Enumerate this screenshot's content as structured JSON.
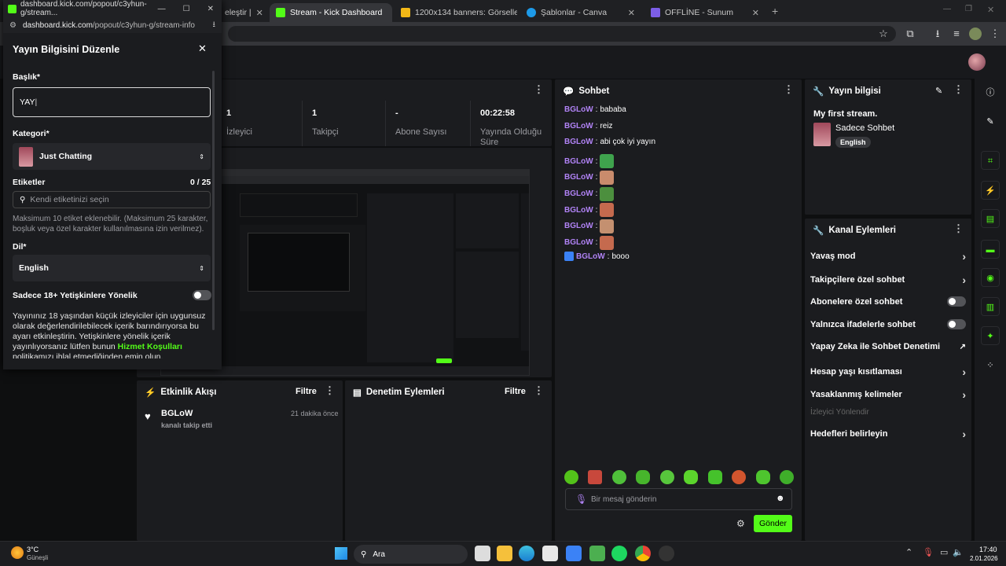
{
  "browser_tabs": [
    {
      "label": "eleştir | ",
      "icon": "gen-icon"
    },
    {
      "label": "Stream - Kick Dashboard",
      "icon": "kick-icon",
      "active": true
    },
    {
      "label": "1200x134 banners: Görselleri g",
      "icon": "banner-icon"
    },
    {
      "label": "Şablonlar - Canva",
      "icon": "canva-icon"
    },
    {
      "label": "OFFLİNE - Sunum",
      "icon": "slides-icon"
    }
  ],
  "popup": {
    "window_title": "dashboard.kick.com/popout/c3yhun-g/stream...",
    "url_host": "dashboard.kick.com",
    "url_path": "/popout/c3yhun-g/stream-info",
    "heading": "Yayın Bilgisini Düzenle",
    "title_label": "Başlık*",
    "title_value": "YAY",
    "category_label": "Kategori*",
    "category_value": "Just Chatting",
    "tags_label": "Etiketler",
    "tags_count": "0 / 25",
    "tags_placeholder": "Kendi etiketinizi seçin",
    "tags_help": "Maksimum 10 etiket eklenebilir. (Maksimum 25 karakter, boşluk veya özel karakter kullanılmasına izin verilmez).",
    "lang_label": "Dil*",
    "lang_value": "English",
    "adult_label": "Sadece 18+ Yetişkinlere Yönelik",
    "adult_help_1": "Yayınınız 18 yaşından küçük izleyiciler için uygunsuz olarak değerlendirilebilecek içerik barındırıyorsa bu ayarı etkinleştirin. Yetişkinlere yönelik içerik yayınlıyorsanız lütfen bunun ",
    "adult_help_link": "Hizmet Koşulları",
    "adult_help_2": " politikamızı ihlal etmediğinden emin olun."
  },
  "stats": [
    {
      "value": "1",
      "label": "İzleyici"
    },
    {
      "value": "1",
      "label": "Takipçi"
    },
    {
      "value": "-",
      "label": "Abone Sayısı"
    },
    {
      "value": "00:22:58",
      "label": "Yayında Olduğu Süre"
    }
  ],
  "chat": {
    "title": "Sohbet",
    "messages": [
      {
        "user": "BGLoW",
        "text": "bababa"
      },
      {
        "user": "BGLoW",
        "text": "reiz"
      },
      {
        "user": "BGLoW",
        "text": "abi çok iyi yayın"
      },
      {
        "user": "BGLoW",
        "emote": "#3fa34d"
      },
      {
        "user": "BGLoW",
        "emote": "#c98b6c"
      },
      {
        "user": "BGLoW",
        "emote": "#4c8f3e"
      },
      {
        "user": "BGLoW",
        "emote": "#c56a4e"
      },
      {
        "user": "BGLoW",
        "emote": "#c49070"
      },
      {
        "user": "BGLoW",
        "emote": "#c56a4e"
      },
      {
        "user": "BGLoW",
        "text": "booo",
        "badge": true
      }
    ],
    "input_placeholder": "Bir mesaj gönderin",
    "send_label": "Gönder"
  },
  "stream_info": {
    "title": "Yayın bilgisi",
    "stream_title": "My first stream.",
    "category": "Sadece Sohbet",
    "language": "English"
  },
  "channel_actions": {
    "title": "Kanal Eylemleri",
    "items": [
      {
        "label": "Yavaş mod",
        "kind": "chevron"
      },
      {
        "label": "Takipçilere özel sohbet",
        "kind": "chevron"
      },
      {
        "label": "Abonelere özel sohbet",
        "kind": "toggle"
      },
      {
        "label": "Yalnızca ifadelerle sohbet",
        "kind": "toggle"
      },
      {
        "label": "Yapay Zeka ile Sohbet Denetimi",
        "kind": "external"
      },
      {
        "label": "Hesap yaşı kısıtlaması",
        "kind": "chevron"
      },
      {
        "label": "Yasaklanmış kelimeler",
        "kind": "chevron"
      },
      {
        "label": "İzleyici Yönlendir",
        "kind": "disabled"
      },
      {
        "label": "Hedefleri belirleyin",
        "kind": "chevron"
      }
    ]
  },
  "activity": {
    "title": "Etkinlik Akışı",
    "filter": "Filtre",
    "event_user": "BGLoW",
    "event_text": "kanalı takip etti",
    "event_time": "21 dakika önce"
  },
  "moderation": {
    "title": "Denetim Eylemleri",
    "filter": "Filtre"
  },
  "taskbar": {
    "temp": "3°C",
    "weather": "Güneşli",
    "search": "Ara",
    "time": "17:40",
    "date": "2.01.2026"
  },
  "colors": {
    "accent": "#53fc18",
    "username": "#b183f6",
    "bg": "#0e0f10",
    "panel": "#1b1c1f"
  }
}
